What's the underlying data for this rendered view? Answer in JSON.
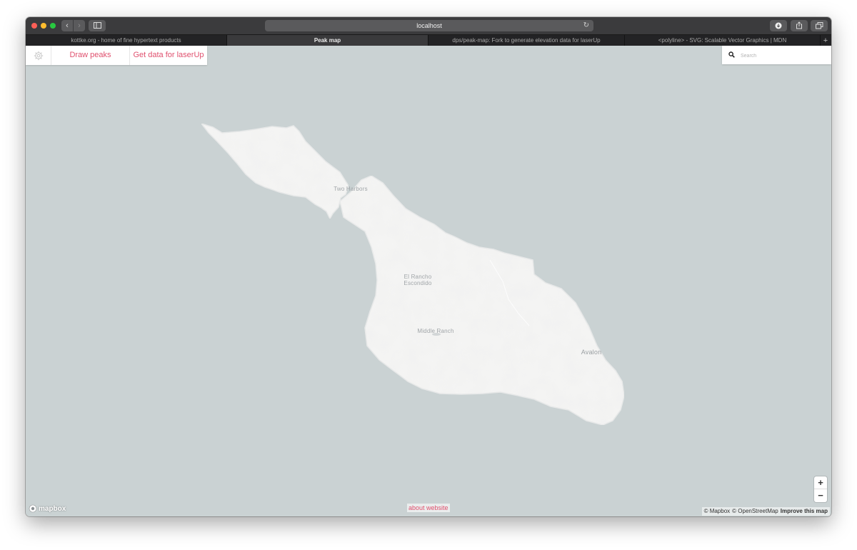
{
  "browser": {
    "url": "localhost",
    "tabs": [
      {
        "label": "kottke.org - home of fine hypertext products",
        "active": false
      },
      {
        "label": "Peak map",
        "active": true
      },
      {
        "label": "dps/peak-map: Fork to generate elevation data for laserUp",
        "active": false
      },
      {
        "label": "<polyline> - SVG: Scalable Vector Graphics | MDN",
        "active": false
      }
    ],
    "new_tab_label": "+"
  },
  "toolbar": {
    "draw_label": "Draw peaks",
    "data_label": "Get data for laserUp"
  },
  "search": {
    "placeholder": "Search"
  },
  "map": {
    "places": {
      "two_harbors": "Two Harbors",
      "el_rancho_1": "El Rancho",
      "el_rancho_2": "Escondido",
      "middle_ranch": "Middle Ranch",
      "avalon": "Avalon"
    },
    "zoom_in": "+",
    "zoom_out": "−",
    "logo": "mapbox",
    "about": "about website",
    "attribution": {
      "mapbox": "© Mapbox",
      "osm": "© OpenStreetMap",
      "improve": "Improve this map"
    }
  },
  "colors": {
    "water": "#cad2d3",
    "land": "#f5f5f4",
    "accent": "#e0506e"
  }
}
